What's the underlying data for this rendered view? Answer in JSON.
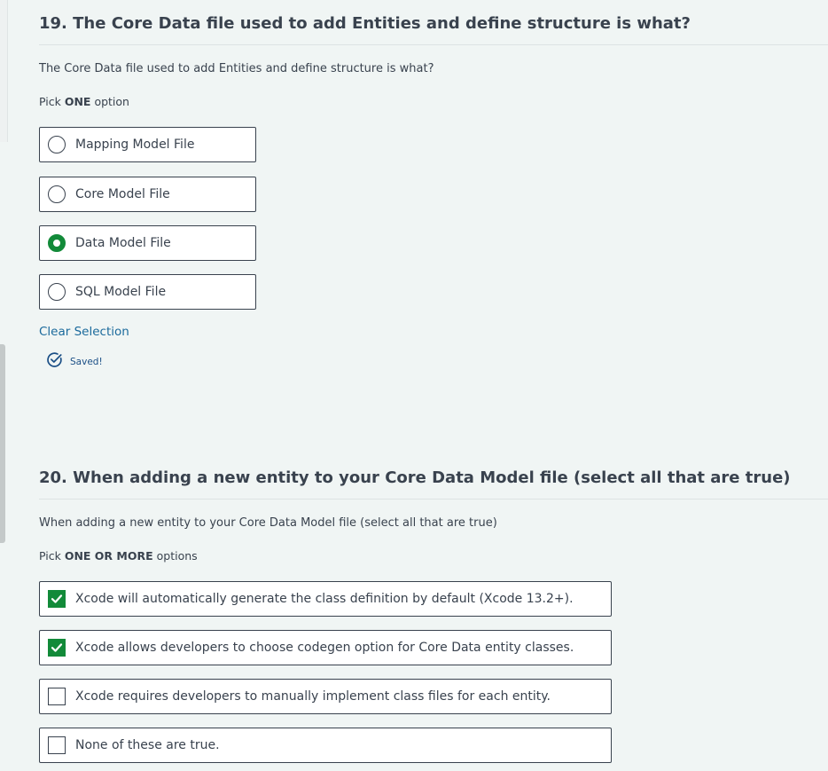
{
  "question19": {
    "title": "19. The Core Data file used to add Entities and define structure is what?",
    "text": "The Core Data file used to add Entities and define structure is what?",
    "hint_prefix": "Pick ",
    "hint_bold": "ONE",
    "hint_suffix": " option",
    "options": [
      {
        "label": "Mapping Model File",
        "selected": false
      },
      {
        "label": "Core Model File",
        "selected": false
      },
      {
        "label": "Data Model File",
        "selected": true
      },
      {
        "label": "SQL Model File",
        "selected": false
      }
    ],
    "clear_label": "Clear Selection",
    "saved_label": "Saved!"
  },
  "question20": {
    "title": "20. When adding a new entity to your Core Data Model file (select all that are true)",
    "text": "When adding a new entity to your Core Data Model file (select all that are true)",
    "hint_prefix": "Pick ",
    "hint_bold": "ONE OR MORE",
    "hint_suffix": " options",
    "options": [
      {
        "label": "Xcode will automatically generate the class definition by default (Xcode 13.2+).",
        "checked": true
      },
      {
        "label": "Xcode allows developers to choose codegen option for Core Data entity classes.",
        "checked": true
      },
      {
        "label": "Xcode requires developers to manually implement class files for each entity.",
        "checked": false
      },
      {
        "label": "None of these are true.",
        "checked": false
      }
    ]
  },
  "colors": {
    "accent_green": "#128a39",
    "link_blue": "#1b6a9c",
    "text": "#39424e",
    "background": "#f0f5f4"
  },
  "icons": {
    "saved": "check-circle-icon",
    "check": "checkmark-icon"
  }
}
